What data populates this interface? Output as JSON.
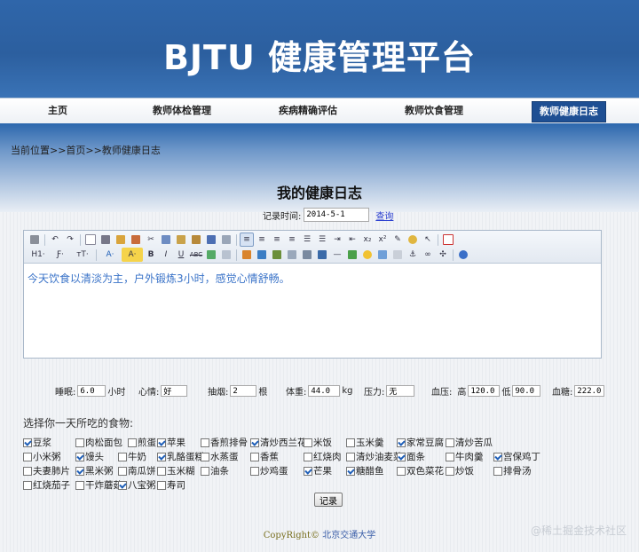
{
  "header": {
    "title": "BJTU 健康管理平台"
  },
  "nav": {
    "items": [
      {
        "label": "主页"
      },
      {
        "label": "教师体检管理"
      },
      {
        "label": "疾病精确评估"
      },
      {
        "label": "教师饮食管理"
      },
      {
        "label": "教师健康日志"
      }
    ]
  },
  "breadcrumb": {
    "text": "当前位置>>首页>>教师健康日志"
  },
  "page": {
    "title": "我的健康日志",
    "record_label": "记录时间:",
    "record_value": "2014-5-1",
    "query_link": "查询"
  },
  "editor": {
    "content": "今天饮食以清淡为主，户外锻炼3小时，感觉心情舒畅。",
    "toolbar_text": {
      "heading": "H1·",
      "font": "Ƒ·",
      "size": "ᴛT·",
      "font_color": "A·",
      "bg_color": "A·",
      "bold": "B",
      "italic": "I",
      "underline": "U",
      "strike": "ABC",
      "sub": "x₂",
      "sup": "x²"
    }
  },
  "metrics": {
    "sleep": {
      "label": "睡眠:",
      "value": "6.0",
      "unit": "小时"
    },
    "mood": {
      "label": "心情:",
      "value": "好"
    },
    "smoke": {
      "label": "抽烟:",
      "value": "2",
      "unit": "根"
    },
    "weight": {
      "label": "体重:",
      "value": "44.0",
      "unit": "kg"
    },
    "pressure": {
      "label": "压力:",
      "value": "无"
    },
    "bp": {
      "label": "血压:",
      "high_label": "高",
      "high": "120.0",
      "low_label": "低",
      "low": "90.0"
    },
    "sugar": {
      "label": "血糖:",
      "value": "222.0"
    }
  },
  "foods": {
    "title": "选择你一天所吃的食物:",
    "rows": [
      [
        {
          "label": "豆浆",
          "checked": true
        },
        {
          "label": "肉松面包",
          "checked": false
        },
        {
          "label": "煎蛋",
          "checked": false
        },
        {
          "label": "苹果",
          "checked": true
        },
        {
          "label": "香煎排骨",
          "checked": false
        },
        {
          "label": "清炒西兰花",
          "checked": true
        },
        {
          "label": "米饭",
          "checked": false
        },
        {
          "label": "玉米羹",
          "checked": false
        },
        {
          "label": "家常豆腐",
          "checked": true
        },
        {
          "label": "清炒苦瓜",
          "checked": false
        }
      ],
      [
        {
          "label": "小米粥",
          "checked": false
        },
        {
          "label": "馒头",
          "checked": true
        },
        {
          "label": "牛奶",
          "checked": false
        },
        {
          "label": "乳酪蛋糕",
          "checked": true
        },
        {
          "label": "水蒸蛋",
          "checked": false
        },
        {
          "label": "香蕉",
          "checked": false
        },
        {
          "label": "红烧肉",
          "checked": false
        },
        {
          "label": "清炒油麦菜",
          "checked": false
        },
        {
          "label": "面条",
          "checked": true
        },
        {
          "label": "牛肉羹",
          "checked": false
        },
        {
          "label": "宫保鸡丁",
          "checked": true
        }
      ],
      [
        {
          "label": "夫妻肺片",
          "checked": false
        },
        {
          "label": "黑米粥",
          "checked": true
        },
        {
          "label": "南瓜饼",
          "checked": false
        },
        {
          "label": "玉米糊",
          "checked": false
        },
        {
          "label": "油条",
          "checked": false
        },
        {
          "label": "炒鸡蛋",
          "checked": false
        },
        {
          "label": "芒果",
          "checked": true
        },
        {
          "label": "糖醋鱼",
          "checked": true
        },
        {
          "label": "双色菜花",
          "checked": false
        },
        {
          "label": "炒饭",
          "checked": false
        },
        {
          "label": "排骨汤",
          "checked": false
        }
      ],
      [
        {
          "label": "红烧茄子",
          "checked": false
        },
        {
          "label": "干炸蘑菇",
          "checked": false
        },
        {
          "label": "八宝粥",
          "checked": true
        },
        {
          "label": "寿司",
          "checked": false
        }
      ]
    ],
    "submit_label": "记录"
  },
  "footer": {
    "copyright": "CopyRight©",
    "org": "北京交通大学"
  },
  "watermark": "@稀土掘金技术社区",
  "colors": {
    "header_bg": "#2f66aa",
    "nav_active": "#1e4f93",
    "editor_text": "#3a73c8"
  }
}
